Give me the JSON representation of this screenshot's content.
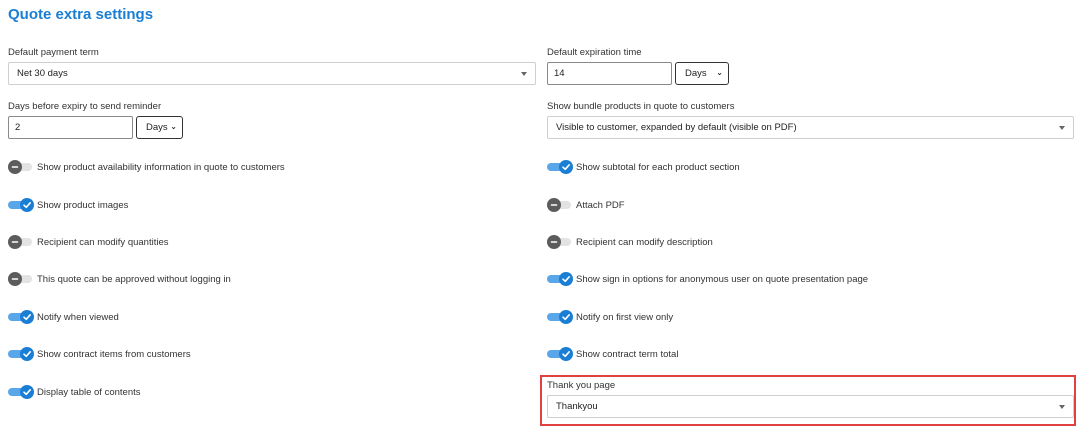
{
  "section_title": "Quote extra settings",
  "payment_term": {
    "label": "Default payment term",
    "value": "Net 30 days"
  },
  "expiration": {
    "label": "Default expiration time",
    "value": "14",
    "unit": "Days"
  },
  "reminder": {
    "label": "Days before expiry to send reminder",
    "value": "2",
    "unit": "Days"
  },
  "bundle": {
    "label": "Show bundle products in quote to customers",
    "value": "Visible to customer, expanded by default (visible on PDF)"
  },
  "toggles": {
    "availability": {
      "label": "Show product availability information in quote to customers",
      "on": false
    },
    "subtotal": {
      "label": "Show subtotal for each product section",
      "on": true
    },
    "images": {
      "label": "Show product images",
      "on": true
    },
    "attach_pdf": {
      "label": "Attach PDF",
      "on": false
    },
    "modify_quantities": {
      "label": "Recipient can modify quantities",
      "on": false
    },
    "modify_description": {
      "label": "Recipient can modify description",
      "on": false
    },
    "approve_without_login": {
      "label": "This quote can be approved without logging in",
      "on": false
    },
    "sign_in_options": {
      "label": "Show sign in options for anonymous user on quote presentation page",
      "on": true
    },
    "notify_viewed": {
      "label": "Notify when viewed",
      "on": true
    },
    "notify_first_view": {
      "label": "Notify on first view only",
      "on": true
    },
    "contract_items": {
      "label": "Show contract items from customers",
      "on": true
    },
    "contract_term_total": {
      "label": "Show contract term total",
      "on": true
    },
    "table_of_contents": {
      "label": "Display table of contents",
      "on": true
    }
  },
  "thank_you": {
    "label": "Thank you page",
    "value": "Thankyou"
  },
  "colors": {
    "accent": "#1a7fd4",
    "track_on": "#5aa6ea",
    "highlight": "#e14040"
  },
  "icons": {
    "on_knob": "check-icon",
    "off_knob": "minus-icon",
    "dropdown": "caret-down-icon"
  }
}
